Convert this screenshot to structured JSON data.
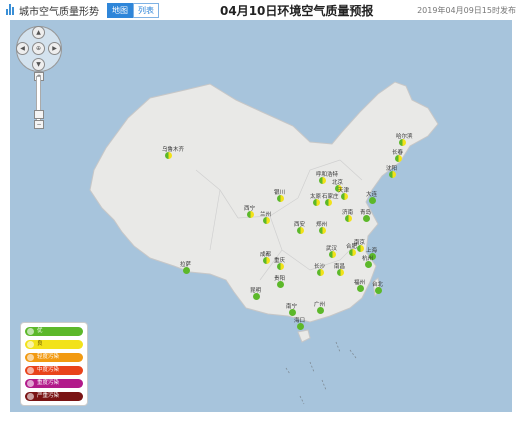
{
  "header": {
    "title": "城市空气质量形势",
    "tabs": [
      {
        "label": "地图",
        "active": true
      },
      {
        "label": "列表",
        "active": false
      }
    ],
    "page_title": "04月10日环境空气质量预报",
    "publish_time": "2019年04月09日15时发布"
  },
  "colors": {
    "good": "#5cb82a",
    "fair": "#f2e21a",
    "light": "#f29a11",
    "moderate": "#e9431b",
    "heavy": "#b21a8a",
    "severe": "#7a1414",
    "accent": "#2f86d9"
  },
  "map": {
    "cities": [
      {
        "name": "乌鲁木齐",
        "status": "fair"
      },
      {
        "name": "哈尔滨",
        "status": "fair"
      },
      {
        "name": "长春",
        "status": "fair"
      },
      {
        "name": "沈阳",
        "status": "fair"
      },
      {
        "name": "呼和浩特",
        "status": "fair"
      },
      {
        "name": "北京",
        "status": "fair"
      },
      {
        "name": "天津",
        "status": "fair"
      },
      {
        "name": "大连",
        "status": "good"
      },
      {
        "name": "太原",
        "status": "fair"
      },
      {
        "name": "石家庄",
        "status": "fair"
      },
      {
        "name": "银川",
        "status": "fair"
      },
      {
        "name": "济南",
        "status": "fair"
      },
      {
        "name": "青岛",
        "status": "good"
      },
      {
        "name": "西宁",
        "status": "fair"
      },
      {
        "name": "兰州",
        "status": "fair"
      },
      {
        "name": "西安",
        "status": "fair"
      },
      {
        "name": "郑州",
        "status": "fair"
      },
      {
        "name": "合肥",
        "status": "fair"
      },
      {
        "name": "南京",
        "status": "fair"
      },
      {
        "name": "上海",
        "status": "good"
      },
      {
        "name": "武汉",
        "status": "fair"
      },
      {
        "name": "杭州",
        "status": "good"
      },
      {
        "name": "成都",
        "status": "fair"
      },
      {
        "name": "重庆",
        "status": "fair"
      },
      {
        "name": "拉萨",
        "status": "good"
      },
      {
        "name": "长沙",
        "status": "fair"
      },
      {
        "name": "南昌",
        "status": "fair"
      },
      {
        "name": "贵阳",
        "status": "good"
      },
      {
        "name": "福州",
        "status": "good"
      },
      {
        "name": "昆明",
        "status": "good"
      },
      {
        "name": "南宁",
        "status": "good"
      },
      {
        "name": "广州",
        "status": "good"
      },
      {
        "name": "台北",
        "status": "good"
      },
      {
        "name": "海口",
        "status": "good"
      }
    ]
  },
  "legend": {
    "items": [
      {
        "label": "优",
        "level": "good"
      },
      {
        "label": "良",
        "level": "fair"
      },
      {
        "label": "轻度污染",
        "level": "light"
      },
      {
        "label": "中度污染",
        "level": "moderate"
      },
      {
        "label": "重度污染",
        "level": "heavy"
      },
      {
        "label": "严重污染",
        "level": "severe"
      }
    ]
  },
  "controls": {
    "pan_up": "▲",
    "pan_down": "▼",
    "pan_left": "◀",
    "pan_right": "▶",
    "pan_center": "⊕",
    "zoom_in": "+",
    "zoom_out": "−",
    "icons": [
      "chart-icon",
      "pan-control-icon",
      "zoom-slider-icon"
    ]
  }
}
